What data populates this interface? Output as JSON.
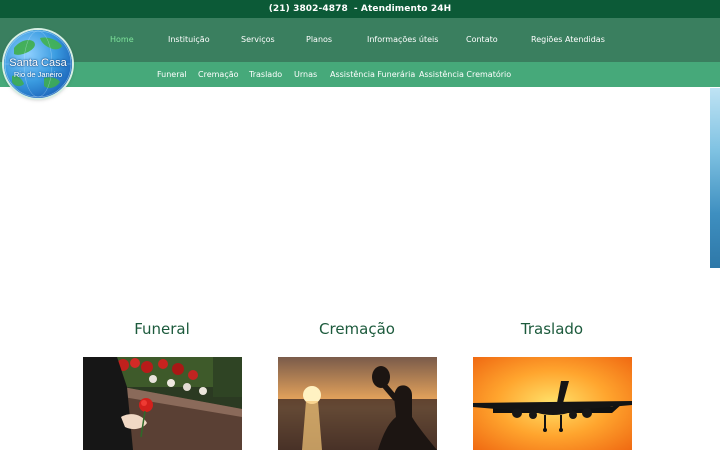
{
  "topbar": {
    "phone": "(21) 3802-4878",
    "hours": "- Atendimento 24H"
  },
  "logo": {
    "line1": "Santa Casa",
    "line2": "Rio de Janeiro",
    "icon": "globe-icon"
  },
  "main_nav": {
    "items": [
      {
        "label": "Home",
        "active": true
      },
      {
        "label": "Instituição",
        "active": false
      },
      {
        "label": "Serviços",
        "active": false
      },
      {
        "label": "Planos",
        "active": false
      },
      {
        "label": "Informações úteis",
        "active": false
      },
      {
        "label": "Contato",
        "active": false
      },
      {
        "label": "Regiões Atendidas",
        "active": false
      }
    ]
  },
  "sub_nav": {
    "items": [
      {
        "label": "Funeral"
      },
      {
        "label": "Cremação"
      },
      {
        "label": "Traslado"
      },
      {
        "label": "Urnas"
      },
      {
        "label": "Assistência Funerária"
      },
      {
        "label": "Assistência Crematório"
      }
    ]
  },
  "services": [
    {
      "title": "Funeral",
      "image": "coffin-with-rose-photo"
    },
    {
      "title": "Cremação",
      "image": "sunset-sea-urn-photo"
    },
    {
      "title": "Traslado",
      "image": "airplane-sunset-photo"
    }
  ],
  "colors": {
    "topbar": "#0c5a37",
    "main_nav": "#3a7f5f",
    "sub_nav": "#46a97a",
    "active_nav": "#7ee39b",
    "service_title": "#1c5a3c"
  }
}
